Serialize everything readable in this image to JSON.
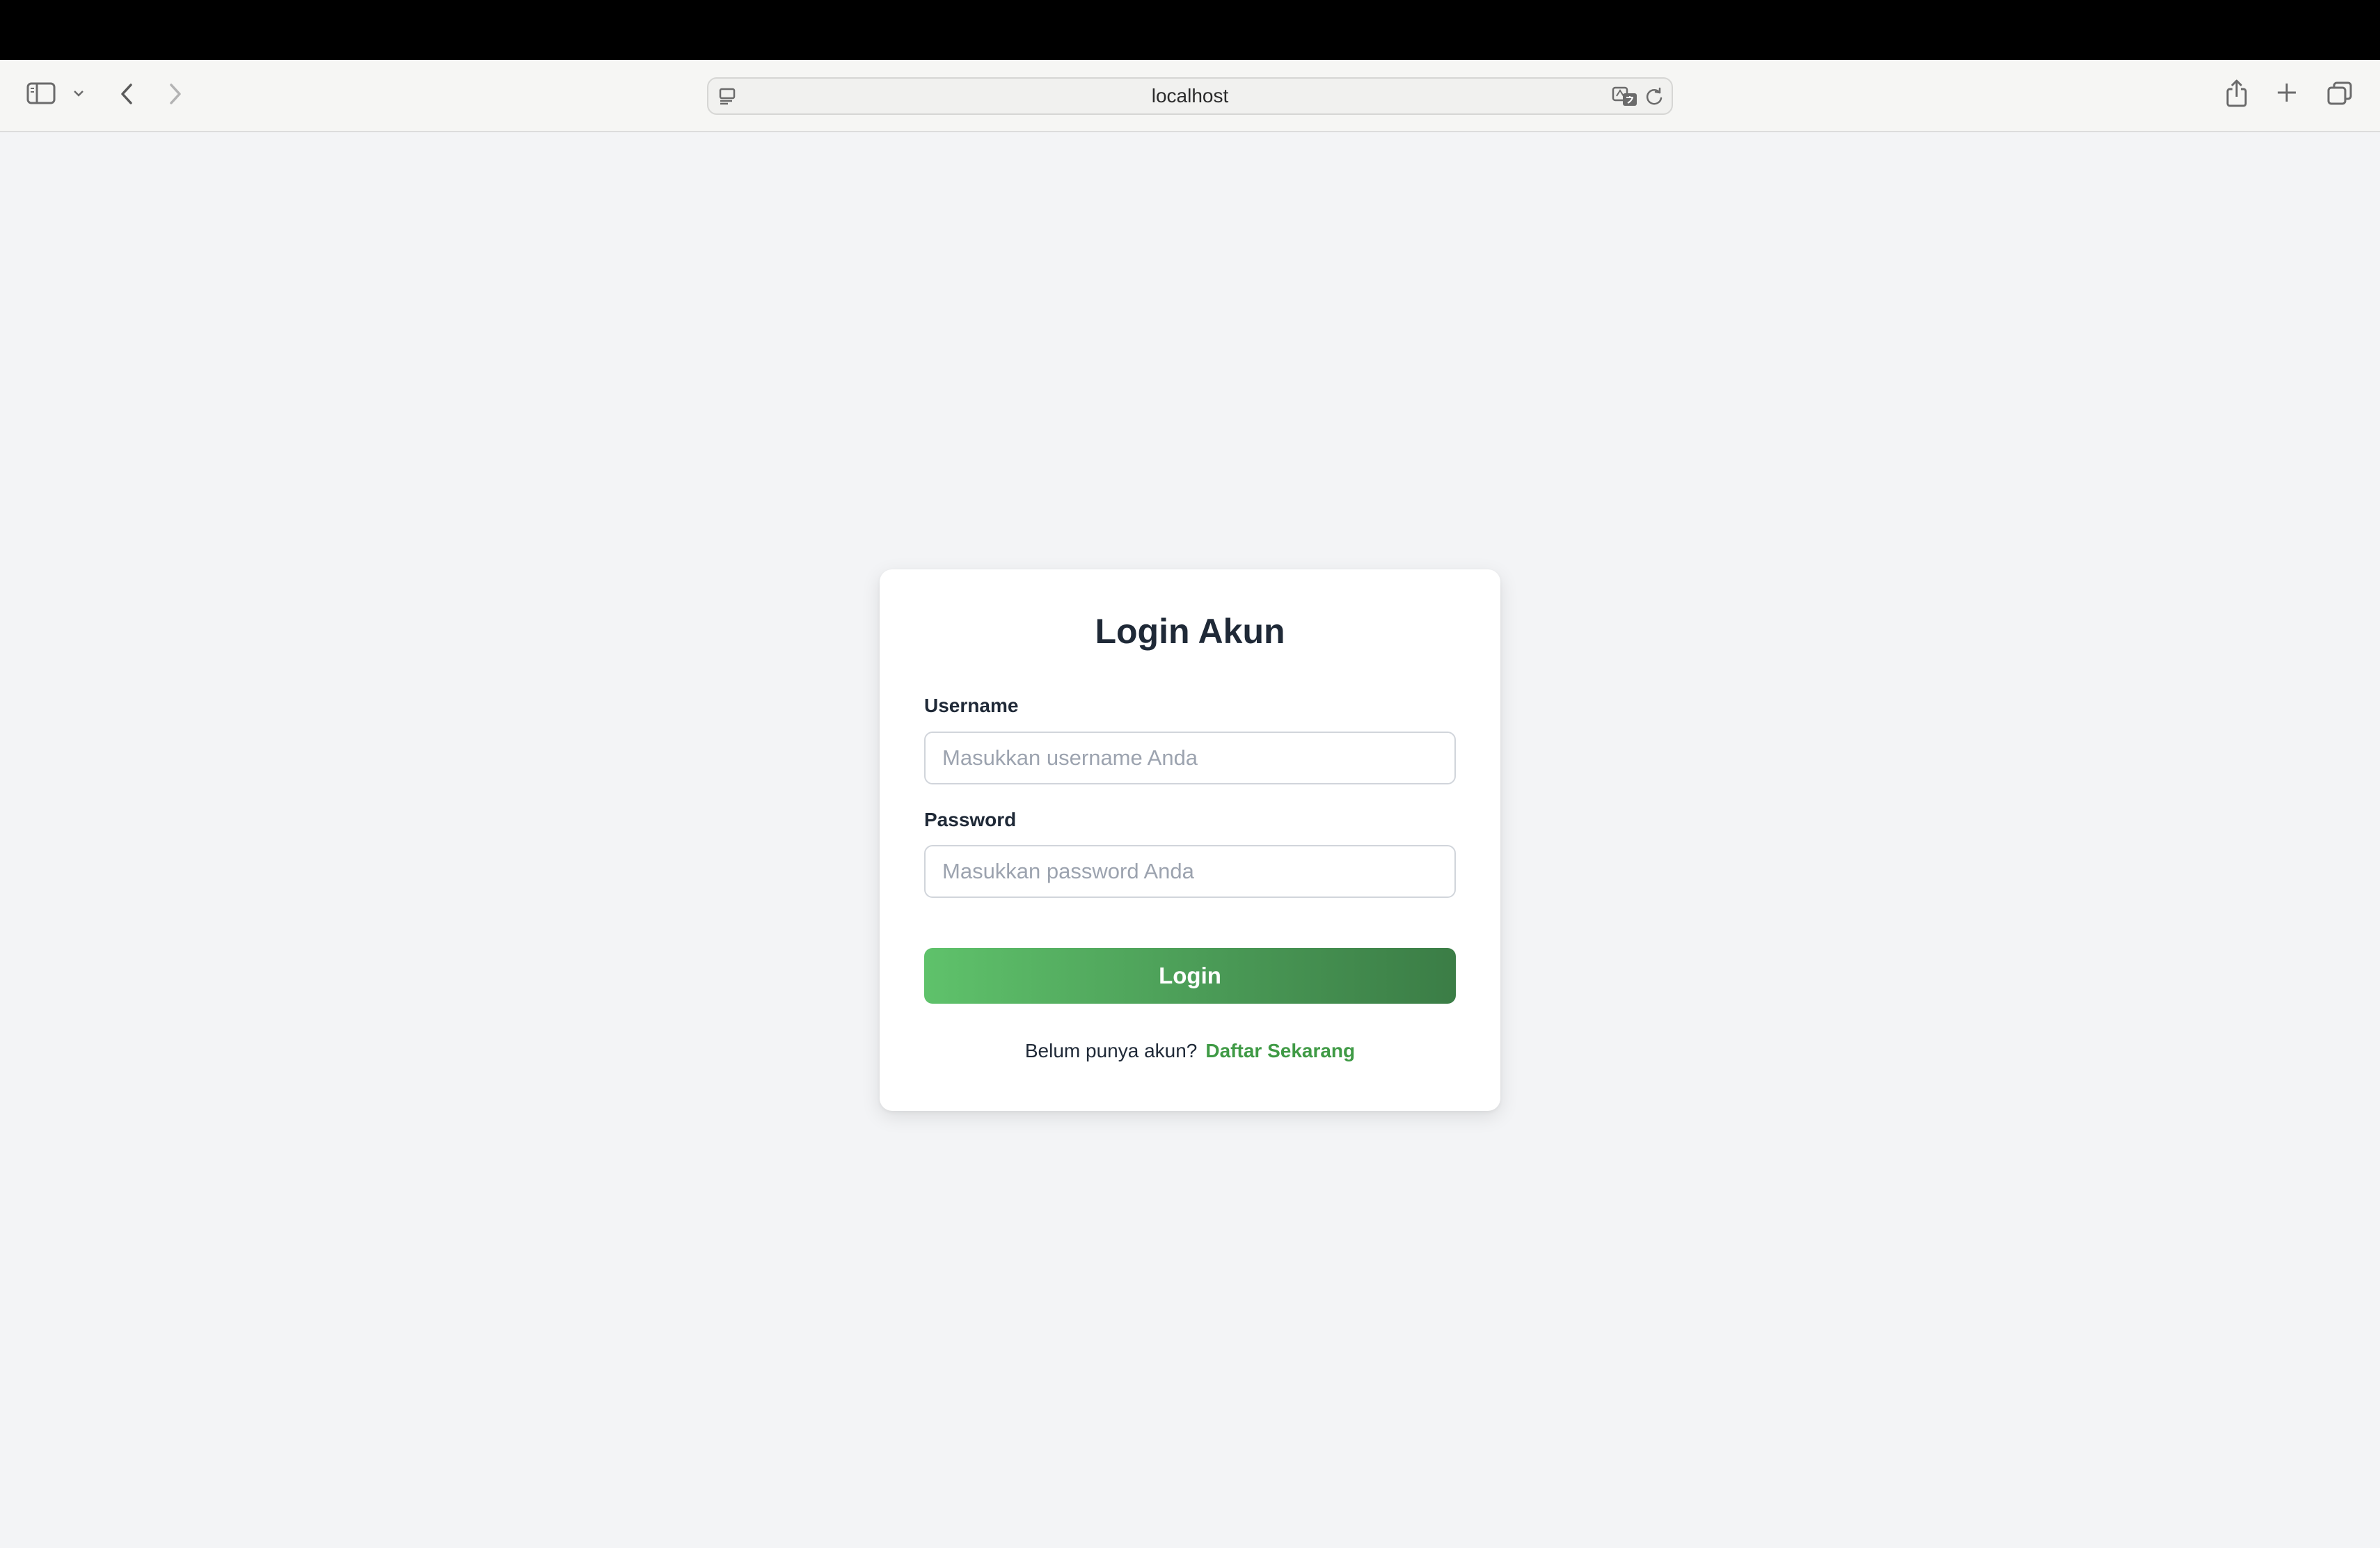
{
  "browser": {
    "url": "localhost",
    "icons": [
      "sidebar-icon",
      "chevron-down-icon",
      "back-icon",
      "forward-icon",
      "site-icon",
      "translate-icon",
      "reload-icon",
      "share-icon",
      "new-tab-icon",
      "tabs-overview-icon"
    ]
  },
  "login": {
    "title": "Login Akun",
    "username_label": "Username",
    "username_placeholder": "Masukkan username Anda",
    "password_label": "Password",
    "password_placeholder": "Masukkan password Anda",
    "submit_label": "Login",
    "register_prompt": "Belum punya akun?",
    "register_link": "Daftar Sekarang"
  },
  "colors": {
    "page_background": "#f3f4f6",
    "button_gradient_start": "#5fc26b",
    "button_gradient_end": "#3b7d46",
    "link": "#3f9a45",
    "title": "#1f2937"
  }
}
